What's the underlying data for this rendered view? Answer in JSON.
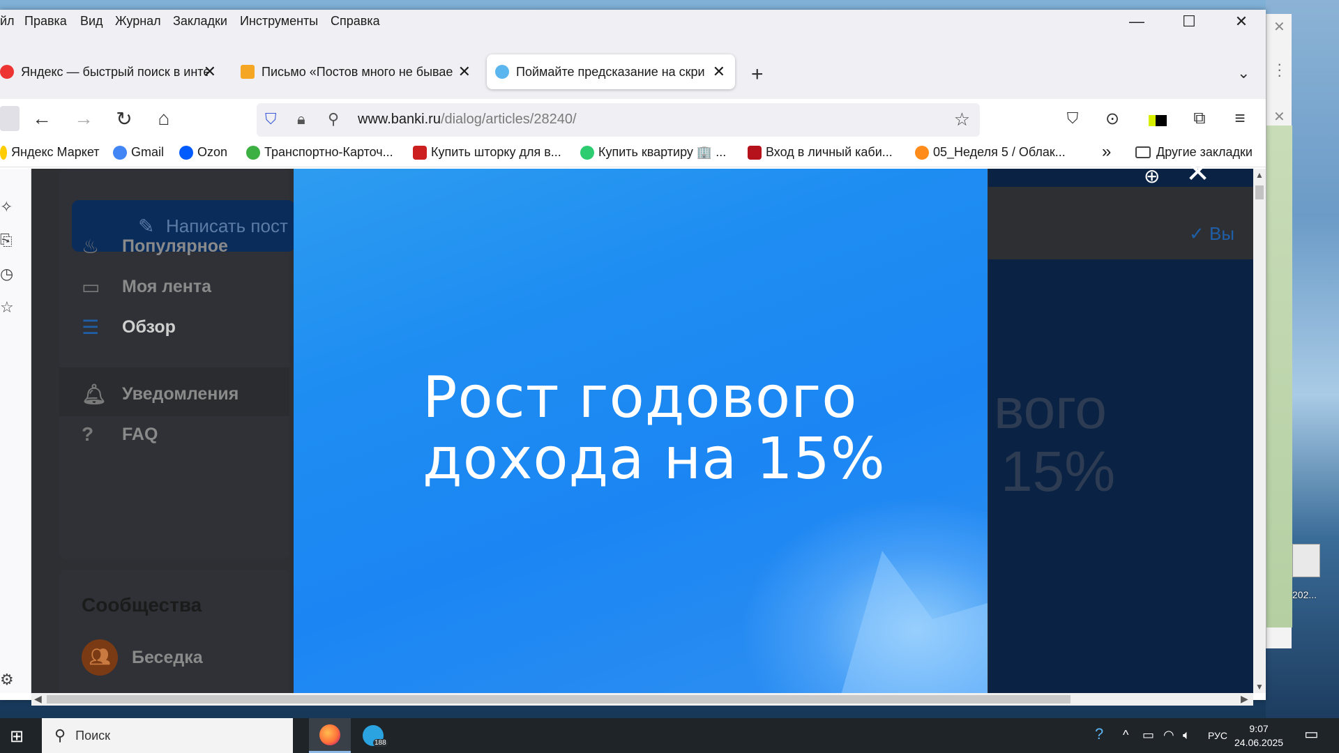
{
  "menubar": {
    "items": [
      "йл",
      "Правка",
      "Вид",
      "Журнал",
      "Закладки",
      "Инструменты",
      "Справка"
    ]
  },
  "window_controls": {
    "minimize": "—",
    "maximize": "☐",
    "close": "✕"
  },
  "tabs": [
    {
      "title": "Яндекс — быстрый поиск в инте",
      "close": "✕",
      "favicon_color": "#e33"
    },
    {
      "title": "Письмо «Постов много не бывае",
      "close": "✕",
      "favicon_color": "#f5a623"
    },
    {
      "title": "Поймайте предсказание на скри",
      "close": "✕",
      "favicon_color": "#5bb6f0",
      "active": true
    }
  ],
  "tab_actions": {
    "new_tab": "+",
    "list_all": "⌄"
  },
  "navbar": {
    "back": "←",
    "forward": "→",
    "reload": "↻",
    "home": "⌂",
    "url_host": "www.banki.ru",
    "url_path": "/dialog/articles/28240/",
    "bookmark_star": "☆"
  },
  "toolbar_right": {
    "pocket": "⛉",
    "account": "⊙",
    "extensions": "⧉",
    "menu": "≡"
  },
  "bookmarks": [
    {
      "label": "Яндекс Маркет",
      "color": "#ffcc00"
    },
    {
      "label": "Gmail",
      "color": "#4285f4"
    },
    {
      "label": "Ozon",
      "color": "#005bff"
    },
    {
      "label": "Транспортно-Карточ...",
      "color": "#3cb043"
    },
    {
      "label": "Купить шторку для в...",
      "color": "#cc1f1f"
    },
    {
      "label": "Купить квартиру 🏢 ...",
      "color": "#2ecc71"
    },
    {
      "label": "Вход в личный каби...",
      "color": "#b5121b"
    },
    {
      "label": "05_Неделя 5 / Облак...",
      "color": "#ff8c1a"
    }
  ],
  "bookmarks_overflow": "»",
  "other_bookmarks": "Другие закладки",
  "page": {
    "write_button": "Написать пост",
    "nav": [
      {
        "label": "Популярное",
        "icon": "fire-icon"
      },
      {
        "label": "Моя лента",
        "icon": "feed-icon"
      },
      {
        "label": "Обзор",
        "icon": "search-list-icon",
        "selected": true
      },
      {
        "label": "Уведомления",
        "icon": "bell-icon"
      },
      {
        "label": "FAQ",
        "icon": "question-icon"
      }
    ],
    "communities_title": "Сообщества",
    "community_item": "Беседка",
    "bg_check_label": "Вы",
    "bg_headline_line1": "вого",
    "bg_headline_line2": "15%"
  },
  "lightbox": {
    "headline_line1": "Рост годового",
    "headline_line2": "дохода на 15%",
    "zoom": "⊕",
    "close": "✕"
  },
  "desktop": {
    "icon_label": "202..."
  },
  "taskbar": {
    "search_placeholder": "Поиск",
    "telegram_badge": "188",
    "lang": "РУС",
    "time": "9:07",
    "date": "24.06.2025"
  }
}
